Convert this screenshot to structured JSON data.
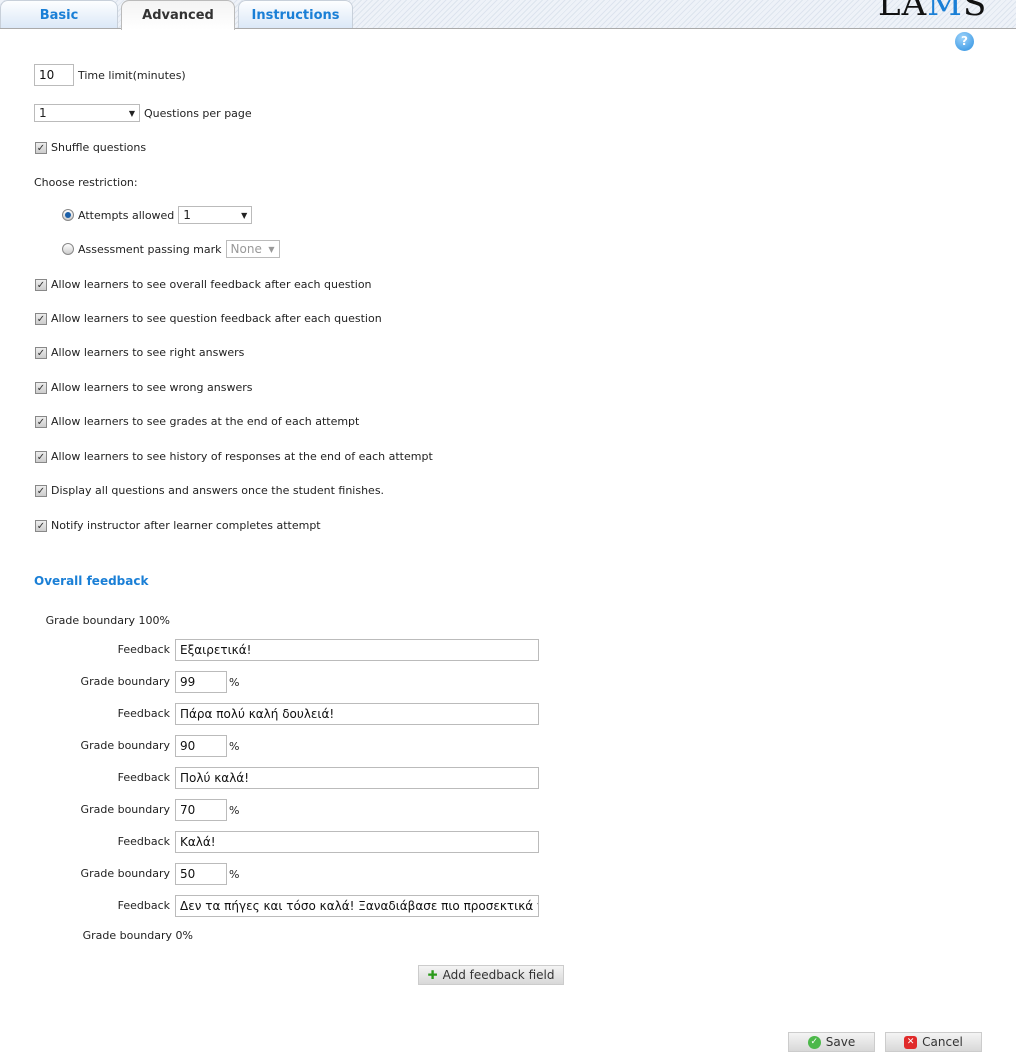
{
  "tabs": [
    {
      "label": "Basic"
    },
    {
      "label": "Advanced",
      "active": true
    },
    {
      "label": "Instructions"
    }
  ],
  "logo": "LAMS",
  "help_icon": "question-circle-icon",
  "time_limit": {
    "value": "10",
    "label": "Time limit(minutes)"
  },
  "questions_per_page": {
    "value": "1",
    "label": "Questions per page"
  },
  "shuffle": {
    "label": "Shuffle questions",
    "checked": true
  },
  "restriction": {
    "label": "Choose restriction:",
    "attempts": {
      "label": "Attempts allowed",
      "value": "1",
      "selected": true
    },
    "passing": {
      "label": "Assessment passing mark",
      "value": "None",
      "selected": false
    }
  },
  "options": [
    {
      "label": "Allow learners to see overall feedback after each question",
      "checked": true
    },
    {
      "label": "Allow learners to see question feedback after each question",
      "checked": true
    },
    {
      "label": "Allow learners to see right answers",
      "checked": true
    },
    {
      "label": "Allow learners to see wrong answers",
      "checked": true
    },
    {
      "label": "Allow learners to see grades at the end of each attempt",
      "checked": true
    },
    {
      "label": "Allow learners to see history of responses at the end of each attempt",
      "checked": true
    },
    {
      "label": "Display all questions and answers once the student finishes.",
      "checked": true
    },
    {
      "label": "Notify instructor after learner completes attempt",
      "checked": true
    }
  ],
  "overall_feedback": {
    "title": "Overall feedback",
    "grade_label": "Grade boundary",
    "feedback_label": "Feedback",
    "percent": "%",
    "top_boundary": "100%",
    "bottom_boundary": "0%",
    "entries": [
      {
        "feedback": "Εξαιρετικά!",
        "boundary": "99"
      },
      {
        "feedback": "Πάρα πολύ καλή δουλειά!",
        "boundary": "90"
      },
      {
        "feedback": "Πολύ καλά!",
        "boundary": "70"
      },
      {
        "feedback": "Καλά!",
        "boundary": "50"
      },
      {
        "feedback": "Δεν τα πήγες και τόσο καλά! Ξαναδιάβασε πιο προσεκτικά τη θεωρία"
      }
    ],
    "add_label": "Add feedback field"
  },
  "save_label": "Save",
  "cancel_label": "Cancel",
  "colors": {
    "accent": "#1a7fd6"
  }
}
